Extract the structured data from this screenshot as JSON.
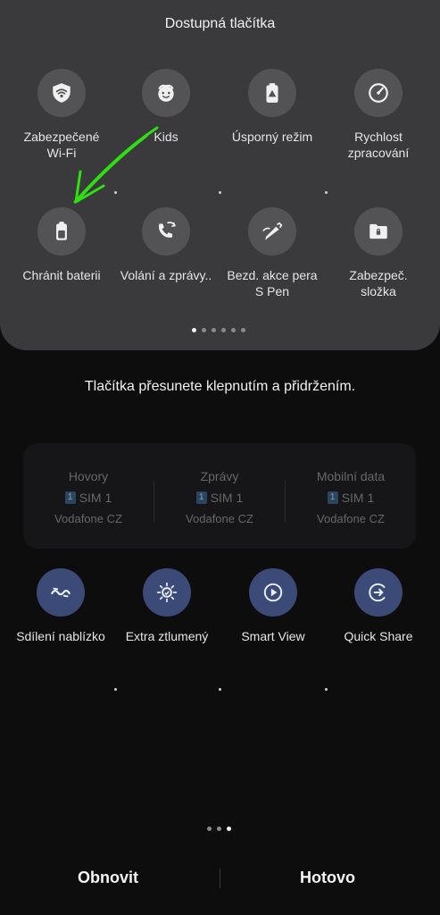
{
  "panel": {
    "title": "Dostupná tlačítka",
    "tiles": [
      {
        "label": "Zabezpečené\nWi-Fi",
        "icon": "secure-wifi-icon"
      },
      {
        "label": "Kids",
        "icon": "kids-face-icon"
      },
      {
        "label": "Úsporný režim",
        "icon": "power-saving-icon"
      },
      {
        "label": "Rychlost\nzpracování",
        "icon": "speedometer-icon"
      },
      {
        "label": "Chránit baterii",
        "icon": "battery-protect-icon"
      },
      {
        "label": "Volání a zprávy..",
        "icon": "calls-messages-icon"
      },
      {
        "label": "Bezd. akce pera\nS Pen",
        "icon": "s-pen-icon"
      },
      {
        "label": "Zabezpeč.\nsložka",
        "icon": "secure-folder-icon"
      }
    ],
    "pager_pages": 6,
    "pager_active": 0
  },
  "hint": "Tlačítka přesunete klepnutím a přidržením.",
  "sim_card": {
    "columns": [
      {
        "name": "Hovory",
        "sim_number": "1",
        "sim": "SIM 1",
        "carrier": "Vodafone CZ"
      },
      {
        "name": "Zprávy",
        "sim_number": "1",
        "sim": "SIM 1",
        "carrier": "Vodafone CZ"
      },
      {
        "name": "Mobilní data",
        "sim_number": "1",
        "sim": "SIM 1",
        "carrier": "Vodafone CZ"
      }
    ]
  },
  "active": {
    "tiles": [
      {
        "label": "Sdílení nablízko",
        "icon": "nearby-share-icon"
      },
      {
        "label": "Extra ztlumený",
        "icon": "extra-dim-icon"
      },
      {
        "label": "Smart View",
        "icon": "smart-view-icon"
      },
      {
        "label": "Quick Share",
        "icon": "quick-share-icon"
      }
    ],
    "pager_pages": 3,
    "pager_active": 2
  },
  "footer": {
    "reset_label": "Obnovit",
    "done_label": "Hotovo"
  },
  "colors": {
    "panel": "#3a3a3c",
    "background": "#0d0d0e",
    "active_circle": "#3c4a78",
    "annotation_arrow": "#2ee012"
  }
}
